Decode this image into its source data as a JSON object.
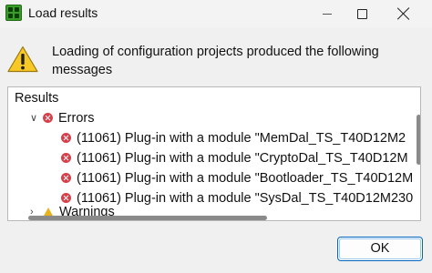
{
  "window": {
    "title": "Load results",
    "controls": {
      "minimize": "minimize",
      "maximize": "maximize",
      "close": "close"
    }
  },
  "message": {
    "icon": "warning-icon",
    "text": "Loading of configuration projects produced the following messages"
  },
  "results": {
    "label": "Results",
    "errors_group": {
      "label": "Errors",
      "expanded": true,
      "items": [
        {
          "text": "(11061) Plug-in with a module \"MemDal_TS_T40D12M2"
        },
        {
          "text": "(11061) Plug-in with a module \"CryptoDal_TS_T40D12M"
        },
        {
          "text": "(11061) Plug-in with a module \"Bootloader_TS_T40D12M"
        },
        {
          "text": "(11061) Plug-in with a module \"SysDal_TS_T40D12M230"
        }
      ]
    },
    "warnings_group": {
      "label": "Warnings",
      "expanded": false
    }
  },
  "buttons": {
    "ok_label": "OK"
  },
  "colors": {
    "accent": "#0067c0",
    "error": "#d6404a",
    "warning": "#e7b21c",
    "app_icon": "#3a9a2a"
  }
}
